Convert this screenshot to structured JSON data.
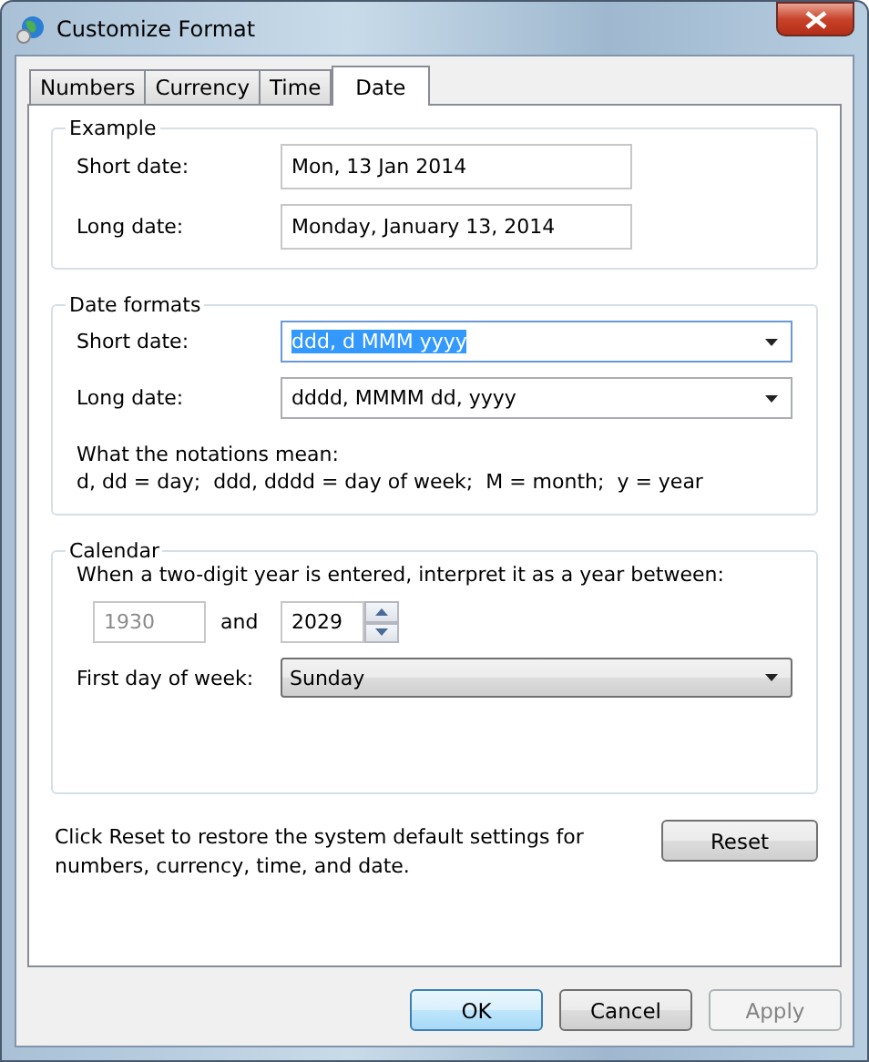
{
  "window": {
    "title": "Customize Format"
  },
  "tabs": [
    {
      "label": "Numbers",
      "selected": false
    },
    {
      "label": "Currency",
      "selected": false
    },
    {
      "label": "Time",
      "selected": false
    },
    {
      "label": "Date",
      "selected": true
    }
  ],
  "example": {
    "title": "Example",
    "rows": [
      {
        "label": "Short date:",
        "value": "Mon, 13 Jan 2014"
      },
      {
        "label": "Long date:",
        "value": "Monday, January 13, 2014"
      }
    ]
  },
  "date_formats": {
    "title": "Date formats",
    "rows": [
      {
        "label": "Short date:",
        "value": "ddd, d MMM yyyy",
        "selected": true
      },
      {
        "label": "Long date:",
        "value": "dddd, MMMM dd, yyyy",
        "selected": false
      }
    ],
    "notes": [
      "What the notations mean:",
      "d, dd = day;  ddd, dddd = day of week;  M = month;  y = year"
    ]
  },
  "calendar": {
    "title": "Calendar",
    "two_digit_label": "When a two-digit year is entered, interpret it as a year between:",
    "year_from": {
      "value": "1930",
      "disabled": true
    },
    "and_label": "and",
    "year_to": {
      "value": "2029"
    },
    "first_day_label": "First day of week:",
    "first_day": "Sunday"
  },
  "reset": {
    "text": "Click Reset to restore the system default settings for numbers, currency, time, and date.",
    "button": "Reset"
  },
  "buttons": [
    {
      "label": "OK",
      "kind": "default",
      "disabled": false
    },
    {
      "label": "Cancel",
      "kind": "normal",
      "disabled": false
    },
    {
      "label": "Apply",
      "kind": "normal",
      "disabled": true
    }
  ]
}
